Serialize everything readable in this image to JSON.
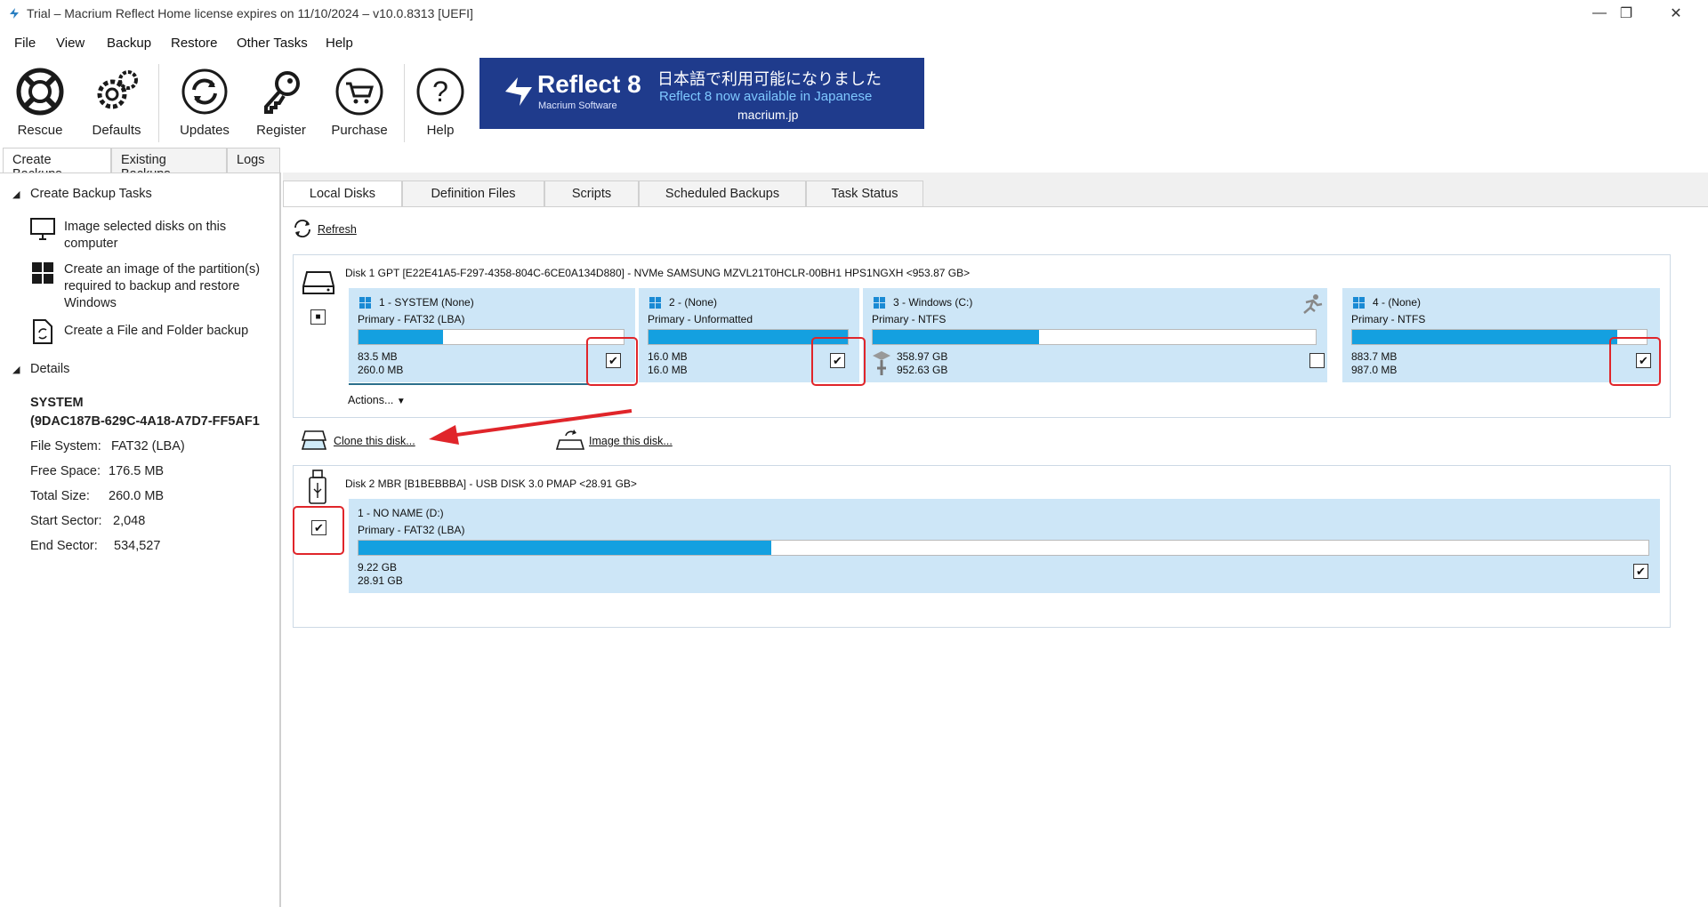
{
  "window": {
    "title": "Trial – Macrium Reflect Home license expires on 11/10/2024 – v10.0.8313  [UEFI]",
    "minimize": "—",
    "restore": "❐",
    "close": "✕"
  },
  "menu": [
    "File",
    "View",
    "Backup",
    "Restore",
    "Other Tasks",
    "Help"
  ],
  "toolbar": {
    "rescue": "Rescue",
    "defaults": "Defaults",
    "updates": "Updates",
    "register": "Register",
    "purchase": "Purchase",
    "help": "Help"
  },
  "banner": {
    "brand": "Reflect 8",
    "sub": "Macrium Software",
    "jp_line": "日本語で利用可能になりました",
    "en_line": "Reflect 8 now available in Japanese",
    "url": "macrium.jp"
  },
  "left_tabs": [
    "Create Backups",
    "Existing Backups",
    "Logs"
  ],
  "left_panel": {
    "tasks_header": "Create Backup Tasks",
    "tasks": [
      "Image selected disks on this computer",
      "Create an image of the partition(s) required to backup and restore Windows",
      "Create a File and Folder backup"
    ],
    "details_header": "Details",
    "details": {
      "name": "SYSTEM",
      "guid": "(9DAC187B-629C-4A18-A7D7-FF5AF1",
      "fs_label": "File System:",
      "fs_value": "FAT32 (LBA)",
      "free_label": "Free Space:",
      "free_value": "176.5 MB",
      "total_label": "Total Size:",
      "total_value": "260.0 MB",
      "start_label": "Start Sector:",
      "start_value": "2,048",
      "end_label": "End Sector:",
      "end_value": "534,527"
    }
  },
  "right_tabs": [
    "Local Disks",
    "Definition Files",
    "Scripts",
    "Scheduled Backups",
    "Task Status"
  ],
  "refresh": "Refresh",
  "disk1": {
    "header": "Disk 1 GPT [E22E41A5-F297-4358-804C-6CE0A134D880] - NVMe SAMSUNG MZVL21T0HCLR-00BH1 HPS1NGXH  <953.87 GB>",
    "disk_checkbox": "■",
    "actions": "Actions...",
    "partitions": [
      {
        "name": "1 - SYSTEM (None)",
        "type": "Primary - FAT32 (LBA)",
        "used": "83.5 MB",
        "total": "260.0 MB",
        "fill": 0.32,
        "checked": "✔"
      },
      {
        "name": "2 -  (None)",
        "type": "Primary - Unformatted",
        "used": "16.0 MB",
        "total": "16.0 MB",
        "fill": 1.0,
        "checked": "✔"
      },
      {
        "name": "3 - Windows (C:)",
        "type": "Primary - NTFS",
        "used": "358.97 GB",
        "total": "952.63 GB",
        "fill": 0.376,
        "checked": ""
      },
      {
        "name": "4 -  (None)",
        "type": "Primary - NTFS",
        "used": "883.7 MB",
        "total": "987.0 MB",
        "fill": 0.9,
        "checked": "✔"
      }
    ]
  },
  "clone_link": "Clone this disk...",
  "image_link": "Image this disk...",
  "disk2": {
    "header": "Disk 2 MBR [B1BEBBBA] - USB DISK 3.0      PMAP  <28.91 GB>",
    "disk_checkbox": "✔",
    "partitions": [
      {
        "name": "1 - NO NAME (D:)",
        "type": "Primary - FAT32 (LBA)",
        "used": "9.22 GB",
        "total": "28.91 GB",
        "fill": 0.32,
        "checked": "✔"
      }
    ]
  },
  "colors": {
    "accent": "#14a0e0",
    "highlight": "#e0252a",
    "partition_bg": "#cde6f7"
  }
}
